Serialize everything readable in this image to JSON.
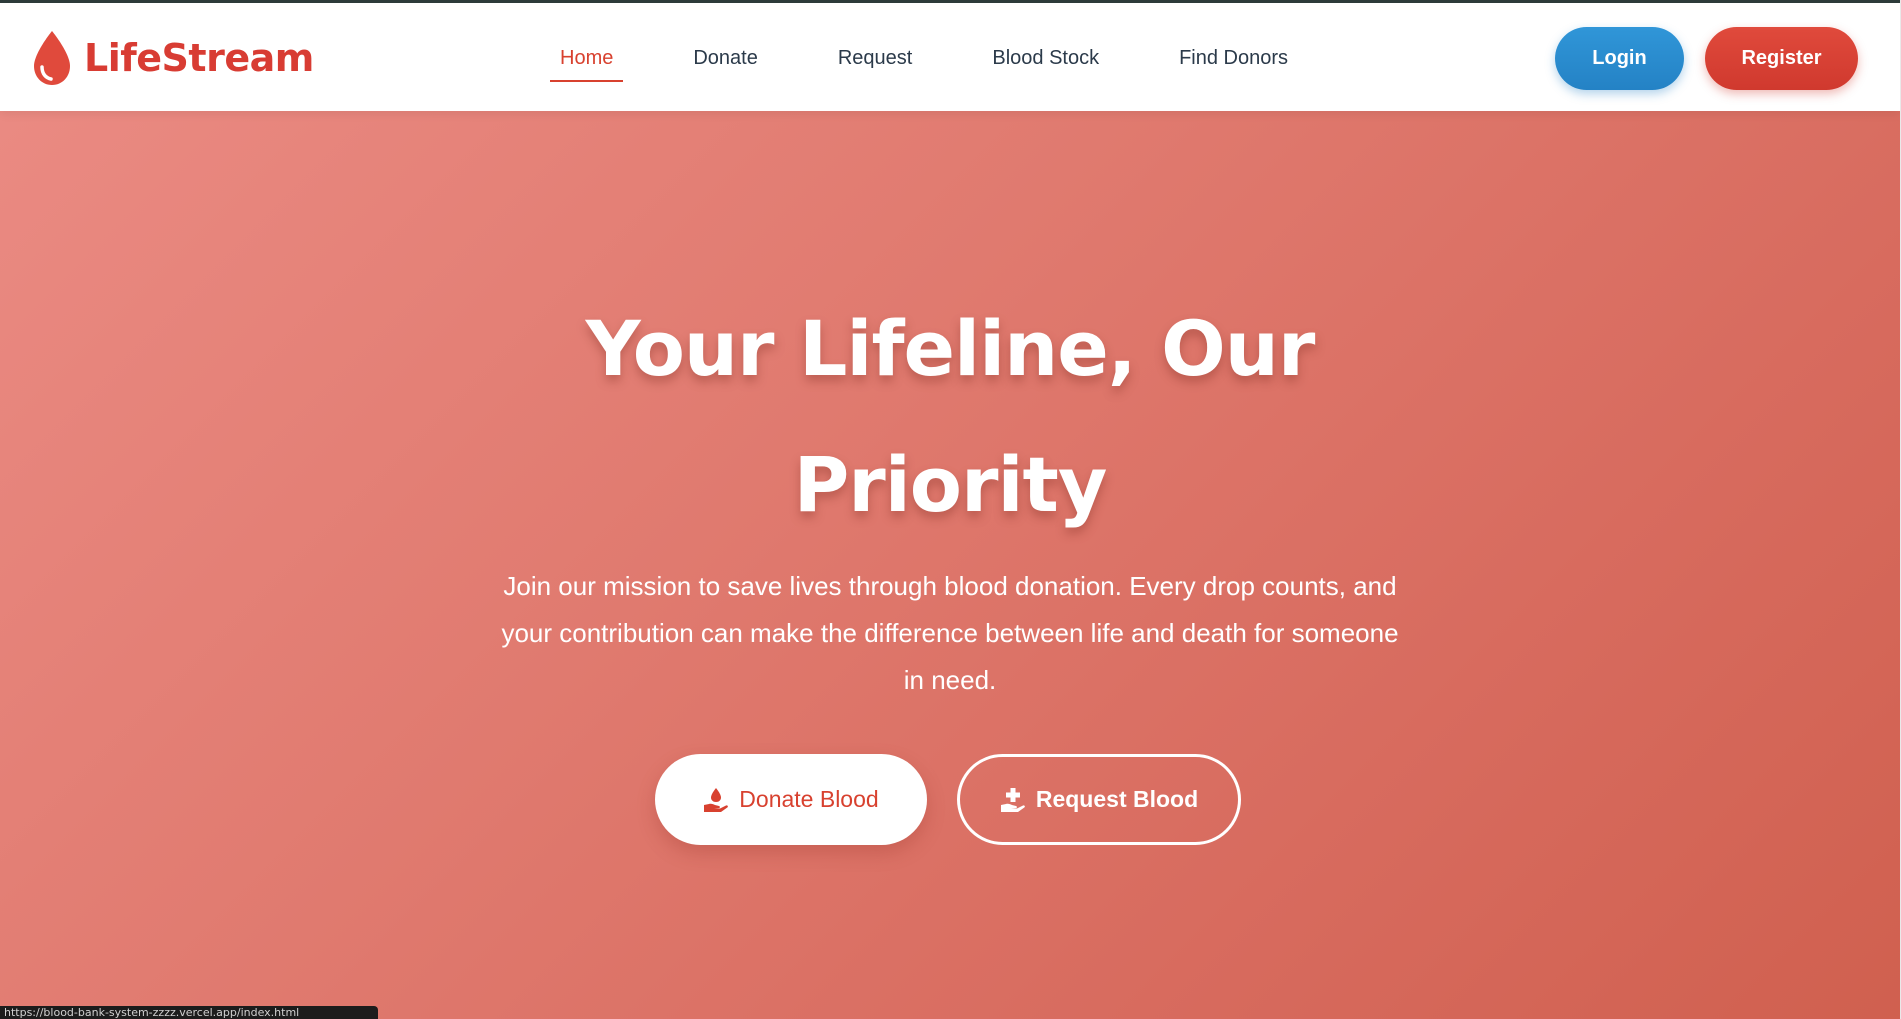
{
  "brand": {
    "name": "LifeStream",
    "icon": "blood-drop-icon",
    "color": "#d83c33"
  },
  "nav": {
    "links": [
      {
        "label": "Home",
        "active": true
      },
      {
        "label": "Donate",
        "active": false
      },
      {
        "label": "Request",
        "active": false
      },
      {
        "label": "Blood Stock",
        "active": false
      },
      {
        "label": "Find Donors",
        "active": false
      }
    ],
    "login_label": "Login",
    "register_label": "Register"
  },
  "hero": {
    "title_line1": "Your Lifeline, Our",
    "title_line2": "Priority",
    "text_line1": "Join our mission to save lives through blood donation. Every drop counts, and",
    "text_line2": "your contribution can make the difference between life and death for someone",
    "text_line3": "in need.",
    "donate_label": "Donate Blood",
    "donate_icon": "hand-holding-drop-icon",
    "request_label": "Request Blood",
    "request_icon": "hand-holding-medical-icon"
  },
  "status_bar": {
    "url": "https://blood-bank-system-zzzz.vercel.app/index.html"
  },
  "colors": {
    "accent_red": "#d8412f",
    "login_blue": "#2482c5",
    "hero_gradient_start": "#ea8a82",
    "hero_gradient_end": "#d0604f",
    "nav_text": "#2b3a4a"
  }
}
